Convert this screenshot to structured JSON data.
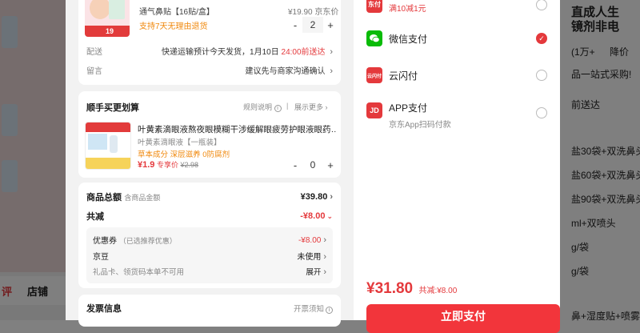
{
  "background": {
    "tabs": [
      "评",
      "店铺"
    ],
    "right_lines": [
      "直成人生",
      "镜剂非电",
      "(1万+",
      "降价",
      "品一站式采购!",
      "前送达",
      "盐30袋+双洗鼻头",
      "盐60袋+双洗鼻头",
      "盐90袋+双洗鼻头",
      "ml+双喷头",
      "g/袋",
      "g/袋",
      "鼻+湿度贴+喷雾"
    ]
  },
  "order": {
    "product": {
      "desc": "通气鼻贴【16贴/盒】",
      "price": "¥19.90 京东价",
      "return_policy": "支持7天无理由退货",
      "thumb_badge": "19",
      "quantity": "2"
    },
    "delivery": {
      "label": "配送",
      "value_prefix": "快递运输预计今天发货，1月10日",
      "value_highlight": "24:00前送达"
    },
    "note": {
      "label": "留言",
      "value": "建议先与商家沟通确认"
    },
    "addon": {
      "title": "顺手买更划算",
      "rules_label": "规则说明",
      "more_label": "展示更多",
      "item_title": "叶黄素滴眼液熬夜眼模糊干涉缓解眼疲劳护眼液眼药…",
      "item_spec": "叶黄素滴眼液【一瓶装】",
      "item_tags": "草本成分 深层滋养 0防腐剂",
      "item_price": "¥1.9",
      "item_price_tag": "专享价",
      "item_orig_price": "¥2.98",
      "item_qty": "0"
    },
    "summary": {
      "total_label": "商品总额",
      "total_note": "含商品金额",
      "total_value": "¥39.80",
      "discount_label": "共减",
      "discount_value": "-¥8.00",
      "coupon_label": "优惠券",
      "coupon_note": "（已选推荐优惠）",
      "coupon_value": "-¥8.00",
      "jd_bean_label": "京豆",
      "jd_bean_value": "未使用",
      "gift_label": "礼品卡、领货码本单不可用",
      "gift_value": "展开"
    },
    "invoice": {
      "title": "发票信息",
      "notice": "开票须知"
    }
  },
  "payment": {
    "top_promo": "满10减1元",
    "top_icon_text": "东付",
    "methods": [
      {
        "name": "微信支付",
        "sub": "",
        "icon": "wechat-pay-icon",
        "selected": true,
        "color": "#09bb07",
        "icon_text": "✓"
      },
      {
        "name": "云闪付",
        "sub": "",
        "icon": "unionpay-quickpass-icon",
        "selected": false,
        "color": "#e4393c",
        "icon_text": "云闪付"
      },
      {
        "name": "APP支付",
        "sub": "京东App扫码付款",
        "icon": "jd-app-icon",
        "selected": false,
        "color": "#e4393c",
        "icon_text": "JD"
      }
    ],
    "total": "¥31.80",
    "total_discount": "共减:¥8.00",
    "pay_button": "立即支付"
  },
  "colors": {
    "accent": "#e4393c",
    "orange": "#f0880c",
    "wechat": "#09bb07"
  }
}
